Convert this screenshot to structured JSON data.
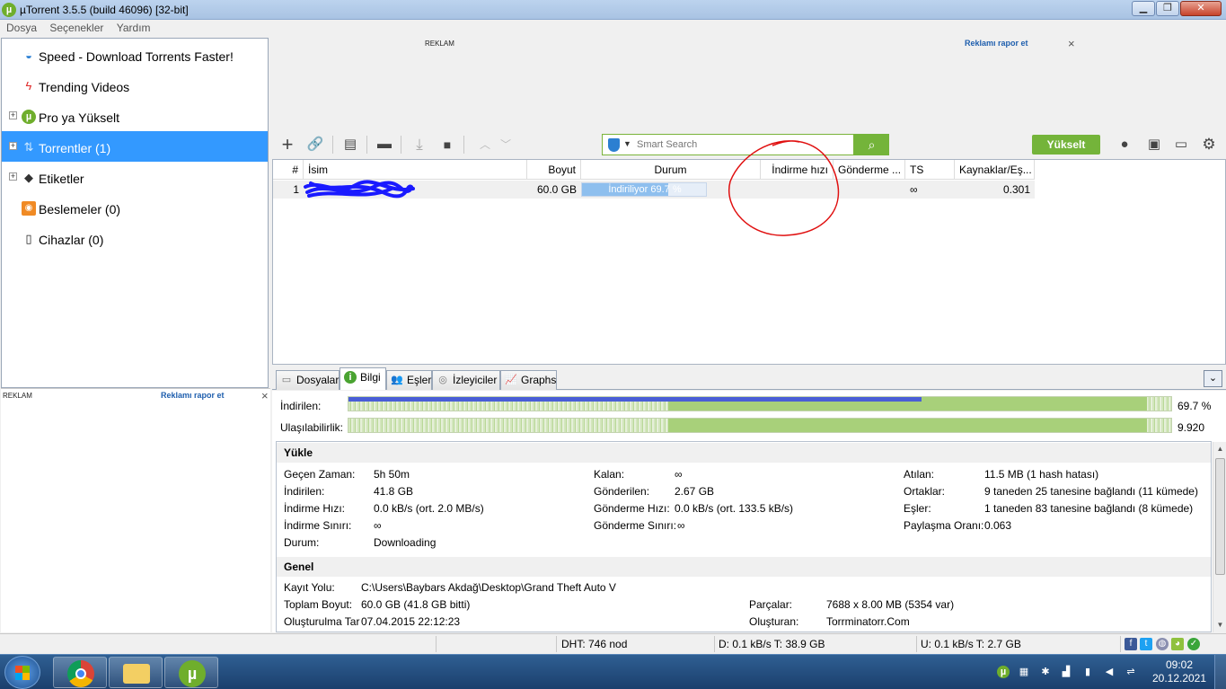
{
  "window": {
    "title": "µTorrent 3.5.5  (build 46096) [32-bit]",
    "min_icon": "minimize-icon",
    "max_icon": "maximize-icon",
    "close_icon": "close-icon"
  },
  "menu": [
    "Dosya",
    "Seçenekler",
    "Yardım"
  ],
  "sidebar": {
    "items": [
      {
        "label": "Speed - Download Torrents Faster!",
        "icon": "speedometer-icon",
        "expander": false,
        "selected": false
      },
      {
        "label": "Trending Videos",
        "icon": "lightning-icon",
        "expander": false,
        "selected": false
      },
      {
        "label": "Pro ya Yükselt",
        "icon": "utorrent-icon",
        "expander": true,
        "selected": false
      },
      {
        "label": "Torrentler (1)",
        "icon": "torrents-icon",
        "expander": true,
        "selected": true
      },
      {
        "label": "Etiketler",
        "icon": "tag-icon",
        "expander": true,
        "selected": false
      },
      {
        "label": "Beslemeler (0)",
        "icon": "rss-icon",
        "expander": false,
        "selected": false
      },
      {
        "label": "Cihazlar (0)",
        "icon": "device-icon",
        "expander": false,
        "selected": false
      }
    ]
  },
  "ads": {
    "top_label": "REKLAM",
    "top_report": "Reklamı rapor et",
    "side_label": "REKLAM",
    "side_report": "Reklamı rapor et",
    "close_glyph": "×"
  },
  "toolbar": {
    "search_placeholder": "Smart Search",
    "upgrade_label": "Yükselt"
  },
  "torrent_list": {
    "columns": [
      "#",
      "İsim",
      "Boyut",
      "Durum",
      "İndirme hızı",
      "Gönderme ...",
      "TS",
      "Kaynaklar/Eş..."
    ],
    "rows": [
      {
        "num": "1",
        "name": "",
        "size": "60.0 GB",
        "status": "İndiriliyor 69.7 %",
        "progress": 0.697,
        "down_speed": "",
        "up_speed": "",
        "eta": "∞",
        "ratio": "0.301"
      }
    ]
  },
  "tabs": [
    {
      "label": "Dosyalar",
      "icon": "files-icon",
      "active": false
    },
    {
      "label": "Bilgi",
      "icon": "info-icon",
      "active": true
    },
    {
      "label": "Eşler",
      "icon": "peers-icon",
      "active": false
    },
    {
      "label": "İzleyiciler",
      "icon": "trackers-icon",
      "active": false
    },
    {
      "label": "Graphs",
      "icon": "graph-icon",
      "active": false
    }
  ],
  "info": {
    "downloaded_label": "İndirilen:",
    "downloaded_value": "69.7 %",
    "downloaded_progress": 0.697,
    "availability_label": "Ulaşılabilirlik:",
    "availability_value": "9.920",
    "transfer_heading": "Yükle",
    "transfer": {
      "col1": [
        {
          "label": "Geçen Zaman:",
          "value": "5h 50m"
        },
        {
          "label": "İndirilen:",
          "value": "41.8 GB"
        },
        {
          "label": "İndirme Hızı:",
          "value": "0.0 kB/s (ort. 2.0 MB/s)"
        },
        {
          "label": "İndirme Sınırı:",
          "value": "∞"
        },
        {
          "label": "Durum:",
          "value": "Downloading"
        }
      ],
      "col2": [
        {
          "label": "Kalan:",
          "value": "∞"
        },
        {
          "label": "Gönderilen:",
          "value": "2.67 GB"
        },
        {
          "label": "Gönderme Hızı:",
          "value": "0.0 kB/s (ort. 133.5 kB/s)"
        },
        {
          "label": "Gönderme Sınırı:",
          "value": "∞"
        }
      ],
      "col3": [
        {
          "label": "Atılan:",
          "value": "11.5 MB (1 hash hatası)"
        },
        {
          "label": "Ortaklar:",
          "value": "9 taneden 25 tanesine bağlandı (11 kümede)"
        },
        {
          "label": "Eşler:",
          "value": "1 taneden 83 tanesine bağlandı (8 kümede)"
        },
        {
          "label": "Paylaşma Oranı:",
          "value": "0.063"
        }
      ]
    },
    "general_heading": "Genel",
    "general": {
      "save_path_label": "Kayıt Yolu:",
      "save_path": "C:\\Users\\Baybars Akdağ\\Desktop\\Grand Theft Auto V",
      "total_size_label": "Toplam Boyut:",
      "total_size": "60.0 GB (41.8 GB bitti)",
      "created_on_label": "Oluşturulma Tar",
      "created_on": "07.04.2015 22:12:23",
      "pieces_label": "Parçalar:",
      "pieces": "7688 x 8.00 MB (5354 var)",
      "created_by_label": "Oluşturan:",
      "created_by": "Torrminatorr.Com"
    }
  },
  "statusbar": {
    "dht": "DHT: 746 nod",
    "down": "D: 0.1 kB/s T: 38.9 GB",
    "up": "U: 0.1 kB/s T: 2.7 GB"
  },
  "taskbar": {
    "time": "09:02",
    "date": "20.12.2021",
    "apps": [
      "chrome-icon",
      "file-explorer-icon",
      "utorrent-icon"
    ]
  },
  "colors": {
    "accent_green": "#74b43a",
    "selection_blue": "#3399ff",
    "annotation_red": "#e01010",
    "scribble_blue": "#1a1aff"
  }
}
